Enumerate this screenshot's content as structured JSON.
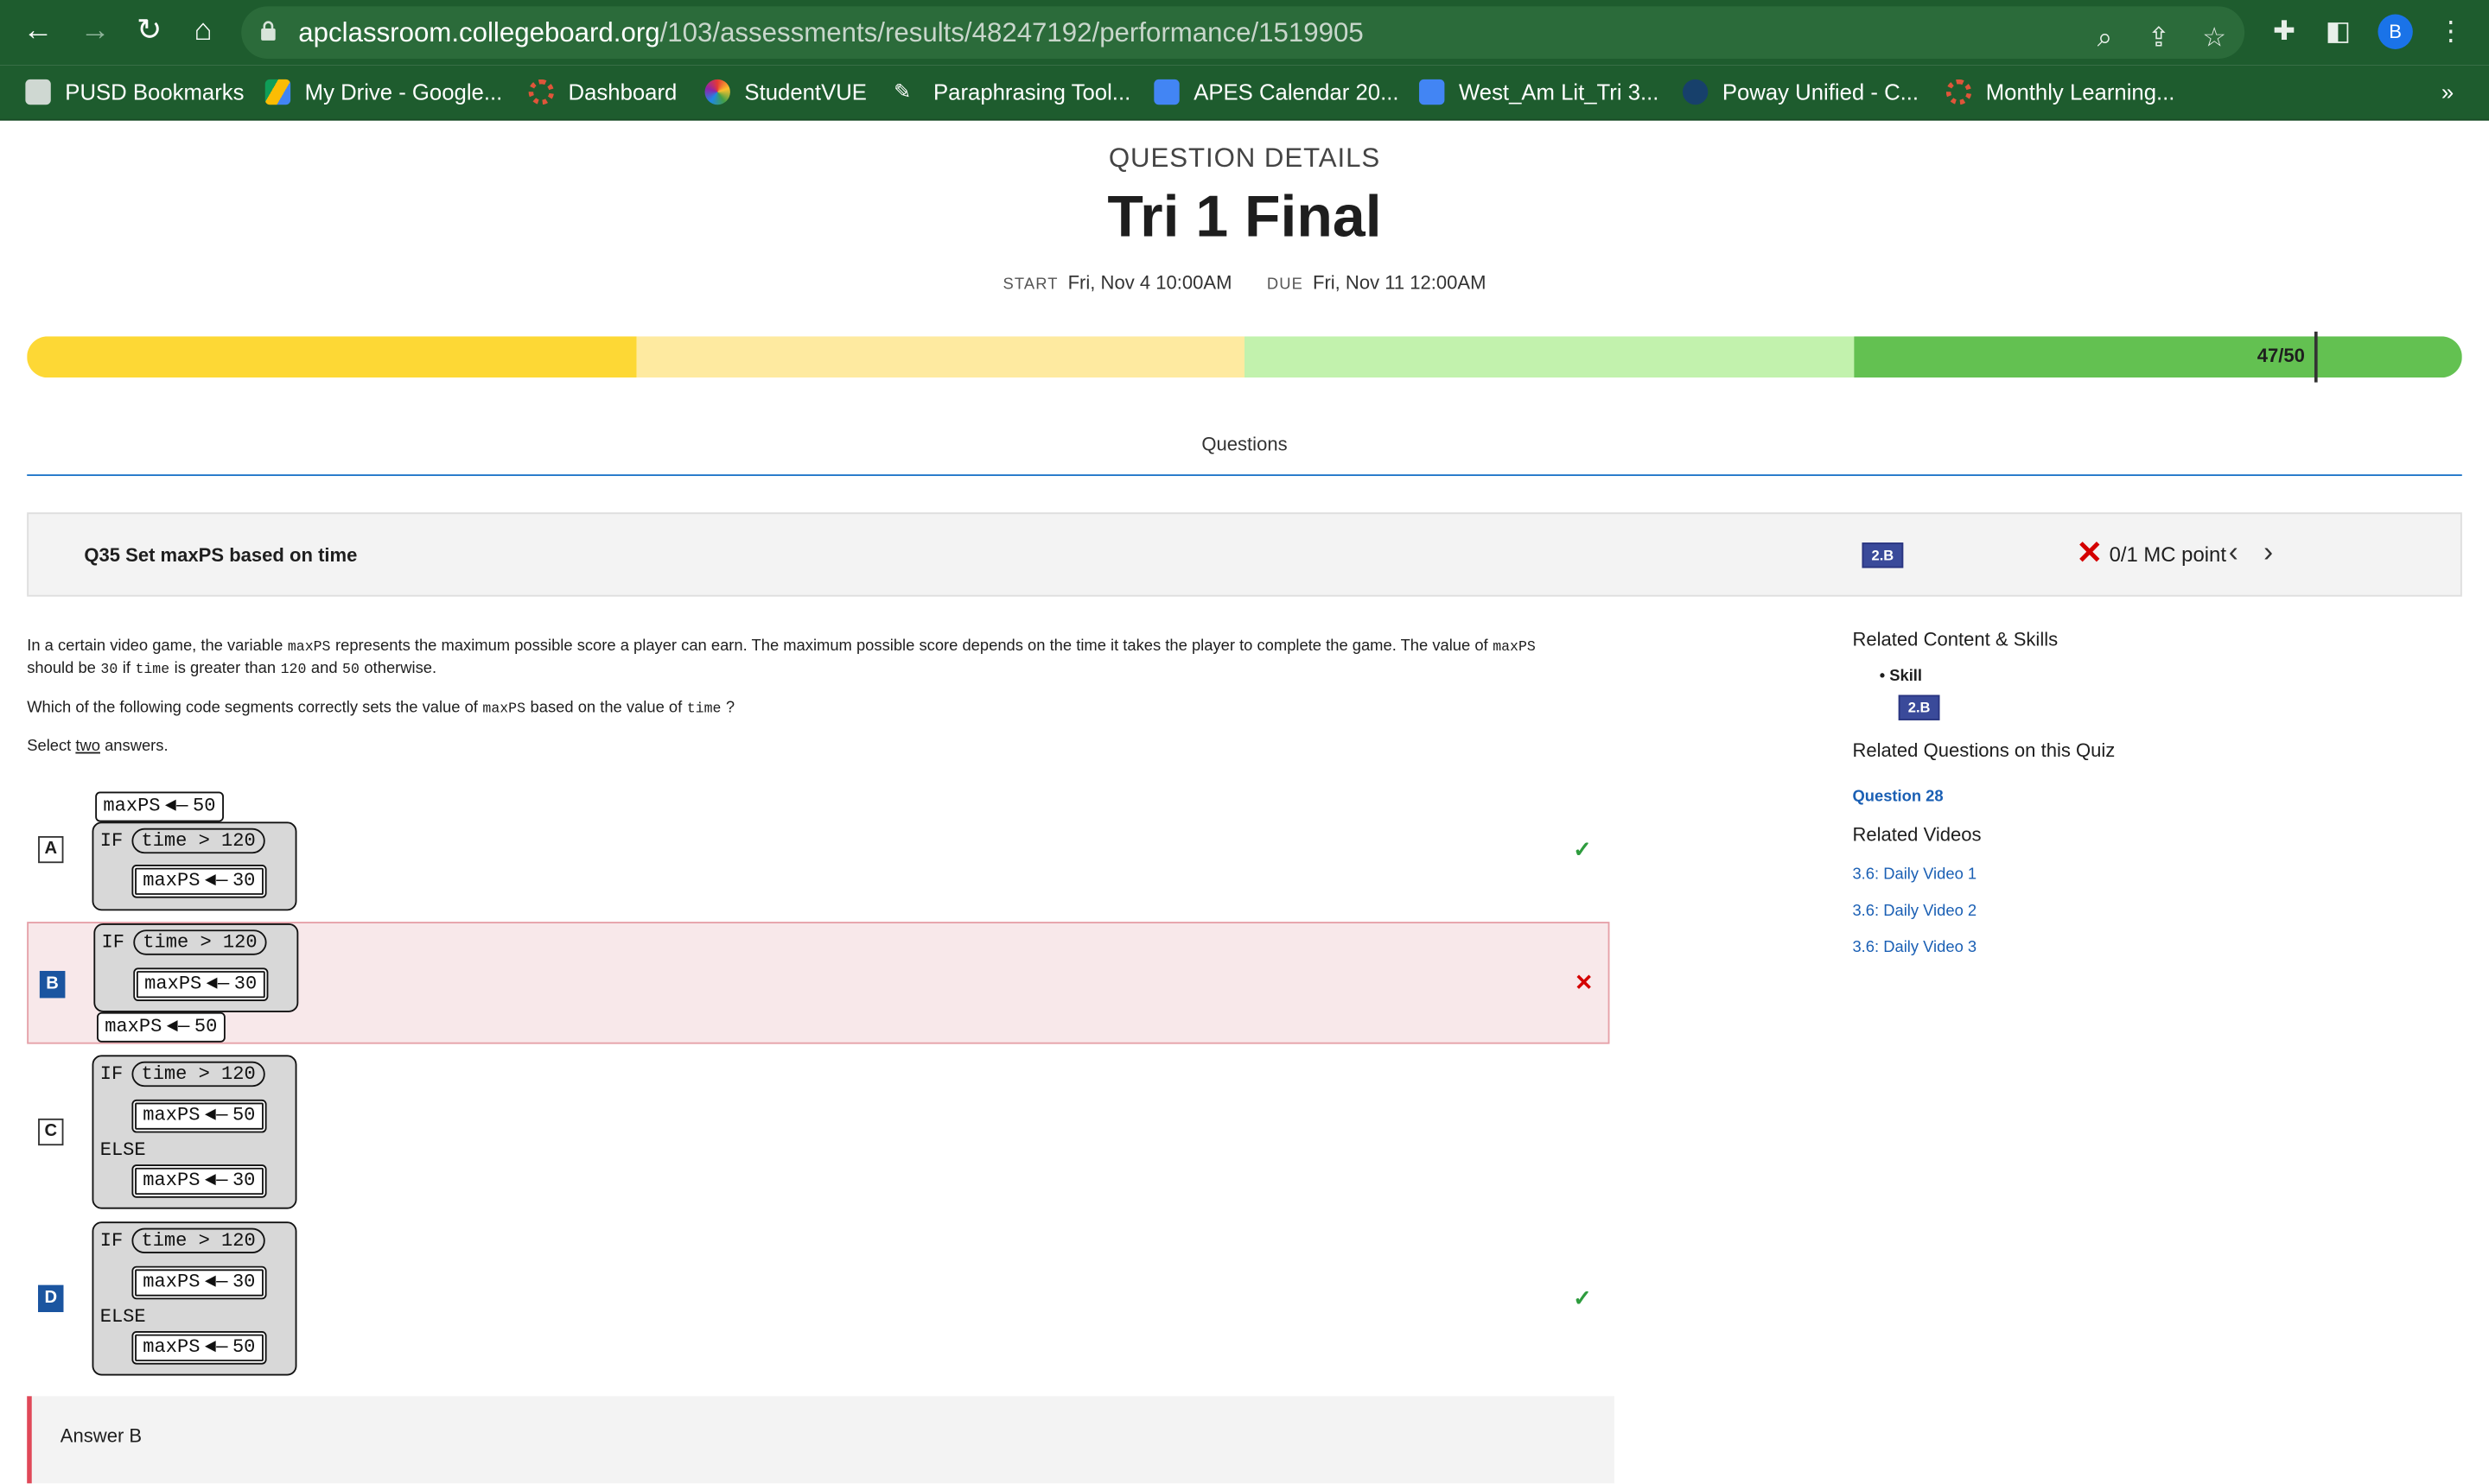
{
  "browser": {
    "url_domain": "apclassroom.collegeboard.org",
    "url_path": "/103/assessments/results/48247192/performance/1519905",
    "avatar_letter": "B",
    "bookmarks": [
      "PUSD Bookmarks",
      "My Drive - Google...",
      "Dashboard",
      "StudentVUE",
      "Paraphrasing Tool...",
      "APES Calendar 20...",
      "West_Am Lit_Tri 3...",
      "Poway Unified - C...",
      "Monthly Learning..."
    ],
    "bookmarks_overflow": "»"
  },
  "header": {
    "section": "QUESTION DETAILS",
    "title": "Tri 1 Final",
    "start_label": "START",
    "start_value": "Fri, Nov 4 10:00AM",
    "due_label": "DUE",
    "due_value": "Fri, Nov 11 12:00AM"
  },
  "score_bar": {
    "score_text": "47/50",
    "score": 47,
    "max": 50,
    "segment_colors": [
      "#fdd835",
      "#feeaa0",
      "#c2f2ad",
      "#63c151"
    ]
  },
  "tabs": {
    "questions": "Questions"
  },
  "question": {
    "title": "Q35 Set maxPS based on time",
    "skill_badge": "2.B",
    "points": "0/1 MC point",
    "stem_parts": [
      "In a certain video game, the variable",
      "maxPS",
      "represents the maximum possible score a player can earn. The maximum possible score depends on the time it takes the player to complete the game. The value of",
      "maxPS",
      "should be",
      "30",
      "if",
      "time",
      "is greater than",
      "120",
      "and",
      "50",
      "otherwise."
    ],
    "prompt_parts": [
      "Which of the following code segments correctly sets the value of",
      "maxPS",
      "based on the value of",
      "time",
      "?"
    ],
    "select_prefix": "Select",
    "select_word": "two",
    "select_suffix": "answers.",
    "code": {
      "if_kw": "IF",
      "else_kw": "ELSE",
      "cond": "time > 120",
      "var": "maxPS",
      "arrow": "◄—",
      "v30": "30",
      "v50": "50"
    },
    "options": [
      {
        "letter": "A",
        "selected": false,
        "status": "correct"
      },
      {
        "letter": "B",
        "selected": true,
        "status": "incorrect"
      },
      {
        "letter": "C",
        "selected": false,
        "status": "none"
      },
      {
        "letter": "D",
        "selected": true,
        "status": "correct"
      }
    ],
    "answer_text": "Answer B"
  },
  "sidebar": {
    "related_heading": "Related Content & Skills",
    "skill_label": "Skill",
    "skill_badge": "2.B",
    "related_questions_heading": "Related Questions on this Quiz",
    "related_question": "Question 28",
    "videos_heading": "Related Videos",
    "videos": [
      "3.6: Daily Video 1",
      "3.6: Daily Video 2",
      "3.6: Daily Video 3"
    ]
  }
}
